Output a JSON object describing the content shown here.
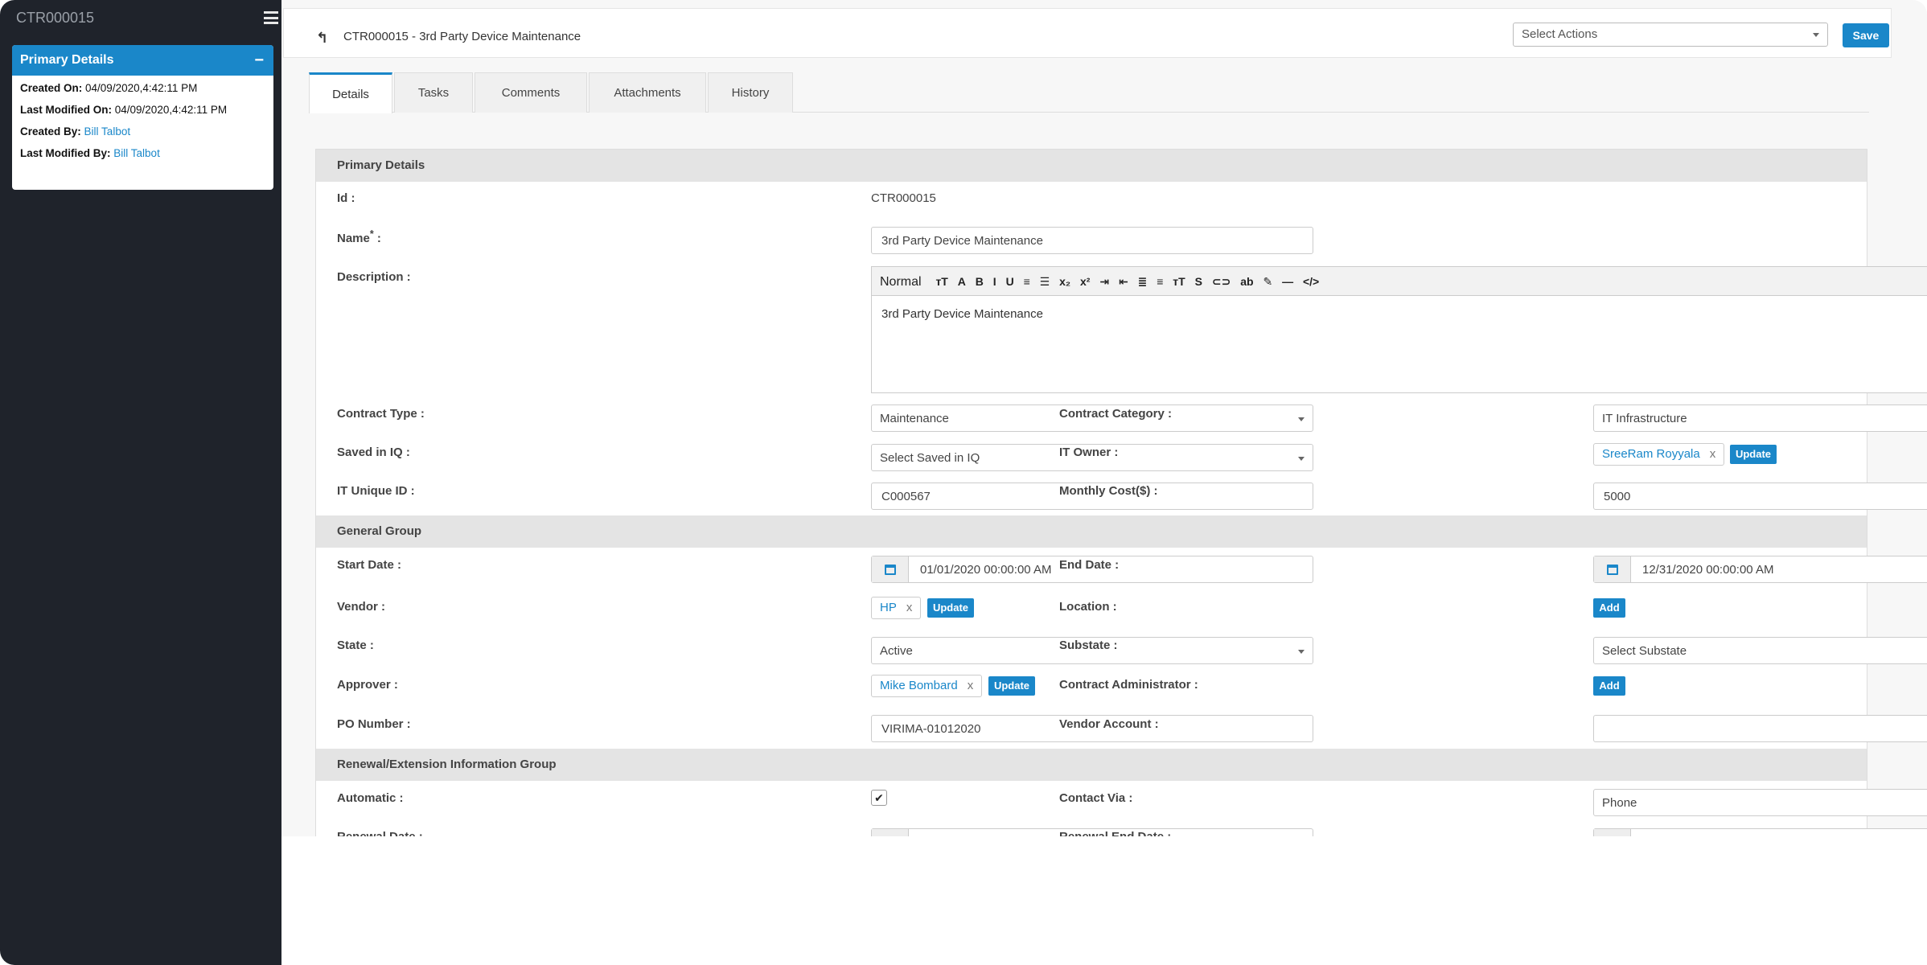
{
  "sidebar": {
    "title": "CTR000015",
    "card": {
      "heading": "Primary Details",
      "collapse_icon": "−",
      "created_on_label": "Created On:",
      "created_on": "04/09/2020,4:42:11 PM",
      "last_modified_on_label": "Last Modified On:",
      "last_modified_on": "04/09/2020,4:42:11 PM",
      "created_by_label": "Created By:",
      "created_by": "Bill Talbot",
      "last_modified_by_label": "Last Modified By:",
      "last_modified_by": "Bill Talbot"
    }
  },
  "header": {
    "back_icon": "↰",
    "record_title": "CTR000015 - 3rd Party Device Maintenance",
    "actions_placeholder": "Select Actions",
    "save_label": "Save"
  },
  "tabs": [
    "Details",
    "Tasks",
    "Comments",
    "Attachments",
    "History"
  ],
  "active_tab": "Details",
  "form": {
    "primary_group": "Primary Details",
    "id_label": "Id :",
    "id_value": "CTR000015",
    "name_label": "Name",
    "name_required": "*",
    "name_colon": " :",
    "name_value": "3rd Party Device Maintenance",
    "description_label": "Description :",
    "rte_format": "Normal",
    "rte_tools": [
      "ᴛT",
      "A",
      "B",
      "I",
      "U",
      "≡",
      "☰",
      "x₂",
      "x²",
      "⇥",
      "⇤",
      "≣",
      "≡",
      "ᴛT",
      "S",
      "⊂⊃",
      "ab",
      "✎",
      "—",
      "</>"
    ],
    "description_value": "3rd Party Device Maintenance",
    "contract_type_label": "Contract Type :",
    "contract_type_value": "Maintenance",
    "contract_category_label": "Contract Category :",
    "contract_category_value": "IT Infrastructure",
    "saved_in_iq_label": "Saved in IQ :",
    "saved_in_iq_value": "Select Saved in IQ",
    "it_owner_label": "IT Owner :",
    "it_owner_value": "SreeRam Royyala",
    "it_unique_id_label": "IT Unique ID :",
    "it_unique_id_value": "C000567",
    "monthly_cost_label": "Monthly Cost($) :",
    "monthly_cost_value": "5000",
    "general_group": "General Group",
    "start_date_label": "Start Date :",
    "start_date_value": "01/01/2020 00:00:00 AM",
    "end_date_label": "End Date :",
    "end_date_value": "12/31/2020 00:00:00 AM",
    "vendor_label": "Vendor :",
    "vendor_value": "HP",
    "location_label": "Location :",
    "state_label": "State :",
    "state_value": "Active",
    "substate_label": "Substate :",
    "substate_value": "Select Substate",
    "approver_label": "Approver :",
    "approver_value": "Mike Bombard",
    "contract_admin_label": "Contract Administrator :",
    "po_number_label": "PO Number :",
    "po_number_value": "VIRIMA-01012020",
    "vendor_account_label": "Vendor Account :",
    "vendor_account_value": "",
    "renewal_group": "Renewal/Extension Information Group",
    "automatic_label": "Automatic :",
    "automatic_check": "✔",
    "contact_via_label": "Contact Via :",
    "contact_via_value": "Phone",
    "renewal_date_label": "Renewal Date :",
    "renewal_end_date_label": "Renewal End Date :",
    "remove_x": "x",
    "update_label": "Update",
    "add_label": "Add"
  },
  "colors": {
    "accent": "#1a87c9",
    "sidebar_bg": "#1f232b",
    "group_bg": "#e4e4e4"
  }
}
